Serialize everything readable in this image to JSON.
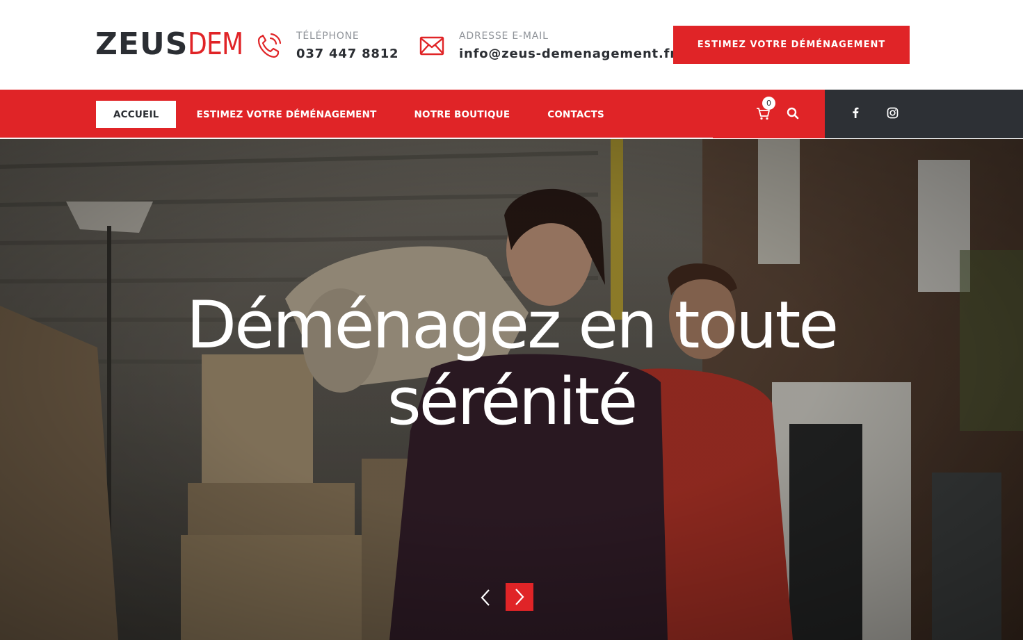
{
  "brand": {
    "logo_part1": "ZEUS",
    "logo_part2": "DEM",
    "accent_color": "#e02427",
    "dark_color": "#2b2e33"
  },
  "header": {
    "phone": {
      "icon": "phone-icon",
      "label": "TÉLÉPHONE",
      "value": "037 447 8812"
    },
    "email": {
      "icon": "envelope-icon",
      "label": "ADRESSE E-MAIL",
      "value": "info@zeus-demenagement.fr"
    },
    "cta_label": "ESTIMEZ VOTRE DÉMÉNAGEMENT"
  },
  "nav": {
    "items": [
      {
        "label": "ACCUEIL",
        "active": true
      },
      {
        "label": "ESTIMEZ VOTRE DÉMÉNAGEMENT",
        "active": false
      },
      {
        "label": "NOTRE BOUTIQUE",
        "active": false
      },
      {
        "label": "CONTACTS",
        "active": false
      }
    ],
    "cart_icon": "cart-icon",
    "cart_count": "0",
    "search_icon": "search-icon",
    "social": [
      "facebook-icon",
      "instagram-icon"
    ]
  },
  "hero": {
    "title_line1": "Déménagez en toute",
    "title_line2": "sérénité",
    "prev_icon": "chevron-left-icon",
    "next_icon": "chevron-right-icon"
  }
}
